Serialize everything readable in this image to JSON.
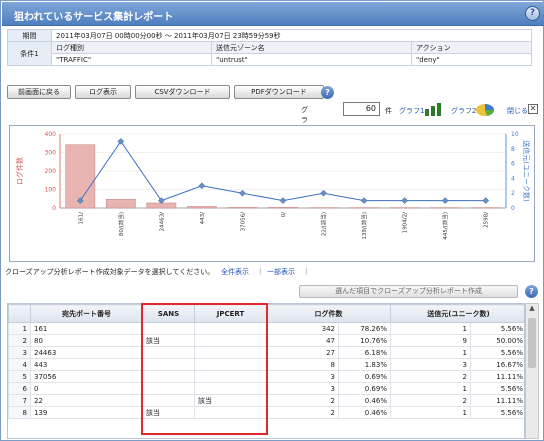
{
  "window": {
    "title": "狙われているサービス集計レポート"
  },
  "conditions": {
    "period_label": "期間",
    "period_value": "2011年03月07日 00時00分00秒 ～ 2011年03月07日 23時59分59秒",
    "cond1_label": "条件1",
    "col_log_type": "ログ種別",
    "col_src_zone": "送信元ゾーン名",
    "col_action": "アクション",
    "val_log_type": "\"TRAFFIC\"",
    "val_src_zone": "\"untrust\"",
    "val_action": "\"deny\""
  },
  "toolbar": {
    "back": "前画面に戻る",
    "log_view": "ログ表示",
    "csv": "CSVダウンロード",
    "pdf": "PDFダウンロード"
  },
  "graph_controls": {
    "count_label": "グラフ件数:",
    "count_value": "60",
    "count_unit": "件",
    "graph1": "グラフ1",
    "graph2": "グラフ2",
    "close": "閉じる"
  },
  "chart_data": {
    "type": "bar",
    "categories": [
      "161/",
      "80/(該当)",
      "24463/",
      "443/",
      "37056/",
      "0/",
      "22/(該当)",
      "139/(該当)",
      "1904/2/",
      "445/(該当)",
      "2598/"
    ],
    "series": [
      {
        "type": "bar",
        "axis": "left",
        "values": [
          342,
          47,
          27,
          8,
          3,
          3,
          2,
          2,
          2,
          2,
          2
        ]
      },
      {
        "type": "line",
        "axis": "right",
        "values": [
          1,
          9,
          1,
          3,
          2,
          1,
          2,
          1,
          1,
          1,
          1
        ]
      }
    ],
    "ylabel": "ログ件数",
    "y2label": "送信元(ユニーク数)",
    "ylim": [
      0,
      400
    ],
    "y2lim": [
      0,
      10
    ],
    "yticks": [
      0,
      100,
      200,
      300,
      400
    ],
    "y2ticks": [
      0,
      2,
      4,
      6,
      8,
      10
    ],
    "bar_color": "#e8b4b2",
    "line_color": "#3a6fc4",
    "colors": {
      "left_axis": "#d9534f",
      "right_axis": "#3a78c8"
    }
  },
  "filter": {
    "hint": "クローズアップ分析レポート作成対象データを選択してください。",
    "all": "全件表示",
    "partial": "一部表示",
    "select_button": "選んだ項目でクローズアップ分析レポート作成"
  },
  "table": {
    "headers": [
      "",
      "宛先ポート番号",
      "SANS",
      "JPCERT",
      "ログ件数",
      "",
      "送信元(ユニーク数)",
      ""
    ],
    "rows": [
      [
        "1",
        "161",
        "",
        "",
        "342",
        "78.26%",
        "1",
        "5.56%"
      ],
      [
        "2",
        "80",
        "該当",
        "",
        "47",
        "10.76%",
        "9",
        "50.00%"
      ],
      [
        "3",
        "24463",
        "",
        "",
        "27",
        "6.18%",
        "1",
        "5.56%"
      ],
      [
        "4",
        "443",
        "",
        "",
        "8",
        "1.83%",
        "3",
        "16.67%"
      ],
      [
        "5",
        "37056",
        "",
        "",
        "3",
        "0.69%",
        "2",
        "11.11%"
      ],
      [
        "6",
        "0",
        "",
        "",
        "3",
        "0.69%",
        "1",
        "5.56%"
      ],
      [
        "7",
        "22",
        "",
        "該当",
        "2",
        "0.46%",
        "2",
        "11.11%"
      ],
      [
        "8",
        "139",
        "該当",
        "",
        "2",
        "0.46%",
        "1",
        "5.56%"
      ]
    ]
  }
}
